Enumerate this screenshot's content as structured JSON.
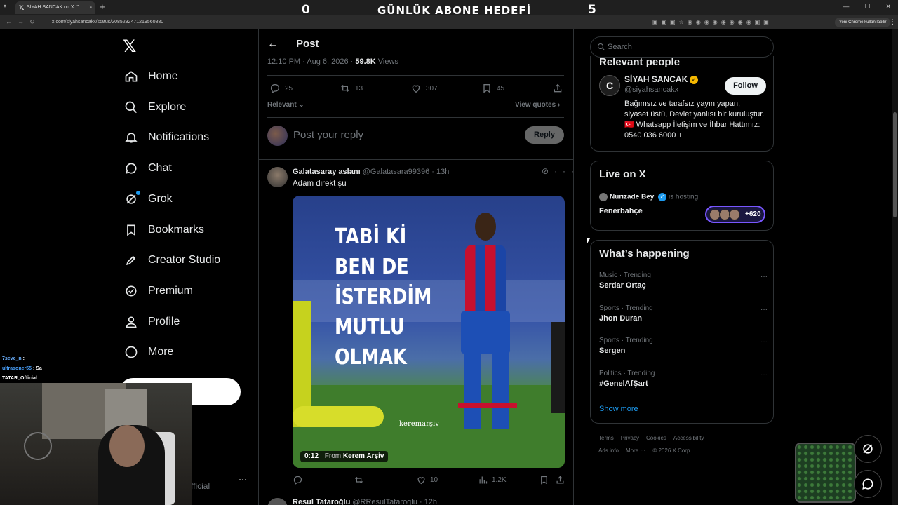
{
  "browser": {
    "tab_title": "SİYAH SANCAK on X: \"",
    "url": "x.com/siyahsancakx/status/2085292471219560880",
    "chrome_pill": "Yeni Chrome kullanılabilir"
  },
  "stream_overlay": {
    "left_count": "0",
    "title": "GÜNLÜK ABONE HEDEFİ",
    "right_count": "5",
    "chat": [
      {
        "user": "7seve_n",
        "msg": ":",
        "color": "#6ab0ff"
      },
      {
        "user": "ultrasoner55",
        "msg": ": Sa",
        "color": "#4aa3ff"
      },
      {
        "user": "TATAR_Official",
        "msg": ":",
        "color": "#ffffff"
      }
    ]
  },
  "sidebar": {
    "items": [
      {
        "label": "Home",
        "icon": "home-icon"
      },
      {
        "label": "Explore",
        "icon": "search-icon"
      },
      {
        "label": "Notifications",
        "icon": "bell-icon"
      },
      {
        "label": "Chat",
        "icon": "chat-icon"
      },
      {
        "label": "Grok",
        "icon": "grok-icon"
      },
      {
        "label": "Bookmarks",
        "icon": "bookmark-icon"
      },
      {
        "label": "Creator Studio",
        "icon": "rocket-icon"
      },
      {
        "label": "Premium",
        "icon": "verified-icon"
      },
      {
        "label": "Profile",
        "icon": "person-icon"
      },
      {
        "label": "More",
        "icon": "more-circle-icon"
      }
    ],
    "profile_fragment": "fficial"
  },
  "post": {
    "header_title": "Post",
    "time": "12:10 PM · Aug 6, 2026 · ",
    "views_count": "59.8K",
    "views_label": " Views",
    "stats": {
      "replies": "25",
      "reposts": "13",
      "likes": "307",
      "bookmarks": "45"
    },
    "sort_label": "Relevant",
    "view_quotes": "View quotes",
    "reply_placeholder": "Post your reply",
    "reply_button": "Reply"
  },
  "reply_tweet": {
    "name": "Galatasaray aslanı",
    "handle": "@Galatasara99396",
    "time": "13h",
    "text": "Adam direkt şu",
    "media_caption": [
      "TABİ Kİ",
      "BEN DE",
      "İSTERDİM",
      "MUTLU",
      "OLMAK"
    ],
    "watermark": "keremarşiv",
    "video_time": "0:12",
    "video_from": "From",
    "video_source": "Kerem Arşiv",
    "actions": {
      "replies": "",
      "reposts": "",
      "likes": "10",
      "views": "1.2K"
    }
  },
  "next_tweet": {
    "name": "Resul Tataroğlu",
    "handle": "@RResulTataroglu",
    "time": "12h"
  },
  "right": {
    "search_placeholder": "Search",
    "relevant_people": {
      "title": "Relevant people",
      "name": "SİYAH SANCAK",
      "handle": "@siyahsancakx",
      "follow": "Follow",
      "bio": "Bağımsız ve tarafsız yayın yapan, siyaset üstü, Devlet yanlısı bir kuruluştur. 🇹🇷 Whatsapp İletişim ve İhbar Hattımız: 0540 036 6000 +"
    },
    "live": {
      "title": "Live on X",
      "host": "Nurizade Bey",
      "hosting_label": "is hosting",
      "room": "Fenerbahçe",
      "listeners": "+620"
    },
    "happening": {
      "title": "What’s happening",
      "trends": [
        {
          "category": "Music · Trending",
          "name": "Serdar Ortaç"
        },
        {
          "category": "Sports · Trending",
          "name": "Jhon Duran"
        },
        {
          "category": "Sports · Trending",
          "name": "Sergen"
        },
        {
          "category": "Politics · Trending",
          "name": "#GenelAfŞart"
        }
      ],
      "show_more": "Show more"
    },
    "footer": {
      "row1": [
        "Terms",
        "Privacy",
        "Cookies",
        "Accessibility"
      ],
      "row2": [
        "Ads info",
        "More ···",
        "© 2026 X Corp."
      ]
    }
  }
}
